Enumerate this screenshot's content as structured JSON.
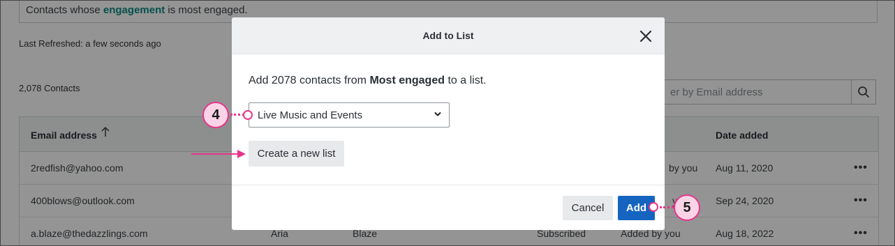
{
  "background": {
    "banner": {
      "prefix": "Contacts whose ",
      "highlight": "engagement",
      "suffix": " is most engaged."
    },
    "last_refreshed": "Last Refreshed: a few seconds ago",
    "contact_count": "2,078 Contacts",
    "search": {
      "placeholder_visible": "er by Email address"
    },
    "table": {
      "headers": {
        "email": "Email address",
        "date_added": "Date added"
      },
      "rows": [
        {
          "email": "2redfish@yahoo.com",
          "first": "",
          "last": "",
          "status": "",
          "source": "by you",
          "date": "Aug 11, 2020"
        },
        {
          "email": "400blows@outlook.com",
          "first": "",
          "last": "",
          "status": "",
          "source": "you",
          "date": "Sep 24, 2020"
        },
        {
          "email": "a.blaze@thedazzlings.com",
          "first": "Aria",
          "last": "Blaze",
          "status": "Subscribed",
          "source": "Added by you",
          "date": "Aug 18, 2022"
        }
      ],
      "row_menu": "•••"
    }
  },
  "modal": {
    "title": "Add to List",
    "description": {
      "prefix": "Add 2078 contacts from ",
      "segment": "Most engaged",
      "suffix": " to a list."
    },
    "select": {
      "selected": "Live Music and Events"
    },
    "create_button": "Create a new list",
    "cancel_button": "Cancel",
    "add_button": "Add"
  },
  "callouts": {
    "step_4": "4",
    "step_5": "5",
    "color": "#e6368a",
    "fill": "#fad4e6"
  },
  "colors": {
    "primary": "#1565c0",
    "highlight": "#0b8a84"
  }
}
